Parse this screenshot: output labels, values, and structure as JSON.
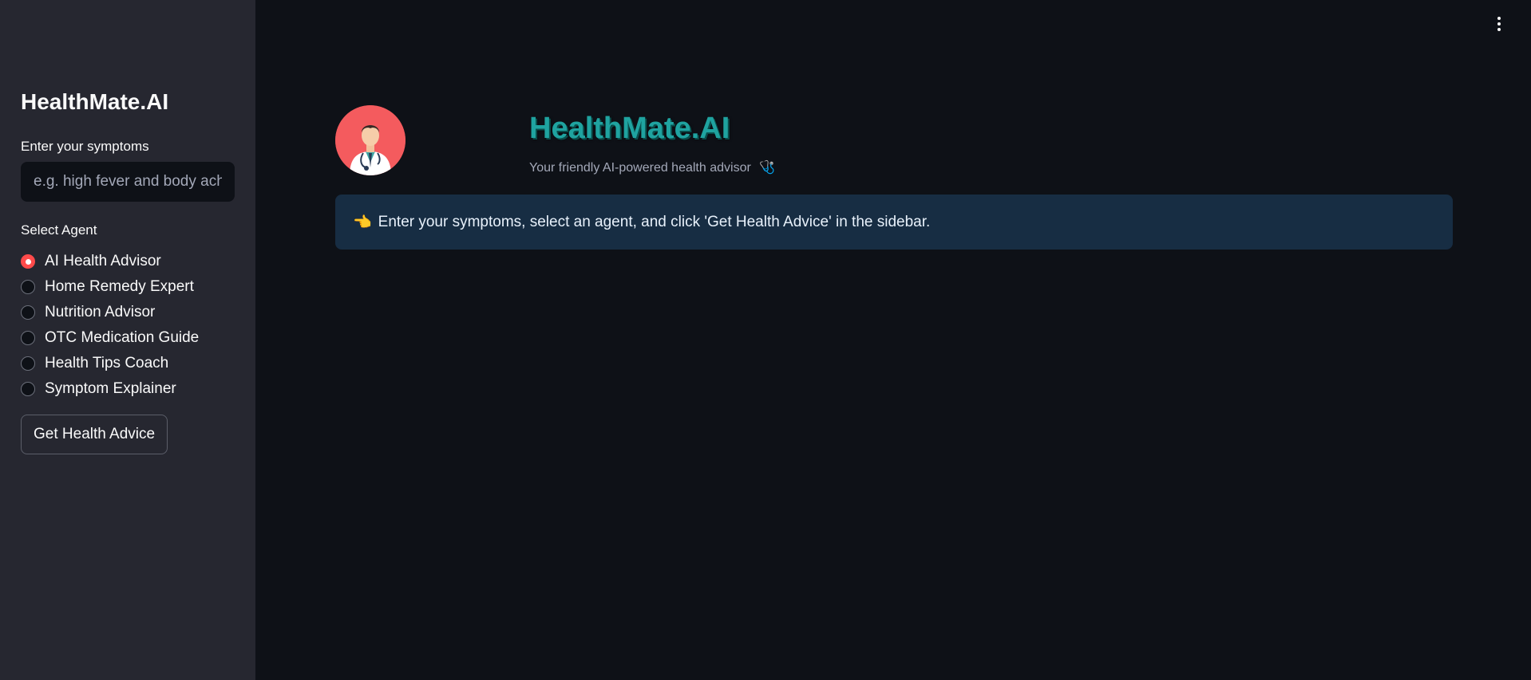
{
  "sidebar": {
    "title": "HealthMate.AI",
    "symptoms_label": "Enter your symptoms",
    "symptoms_placeholder": "e.g. high fever and body ache",
    "symptoms_value": "",
    "agent_label": "Select Agent",
    "agents": [
      {
        "label": "AI Health Advisor",
        "selected": true
      },
      {
        "label": "Home Remedy Expert",
        "selected": false
      },
      {
        "label": "Nutrition Advisor",
        "selected": false
      },
      {
        "label": "OTC Medication Guide",
        "selected": false
      },
      {
        "label": "Health Tips Coach",
        "selected": false
      },
      {
        "label": "Symptom Explainer",
        "selected": false
      }
    ],
    "button_label": "Get Health Advice"
  },
  "main": {
    "title": "HealthMate.AI",
    "subtitle": "Your friendly AI-powered health advisor",
    "subtitle_icon": "🩺",
    "info_icon": "👈",
    "info_text": "Enter your symptoms, select an agent, and click 'Get Health Advice' in the sidebar."
  },
  "colors": {
    "accent": "#ff4b4b",
    "title": "#1fa3a0",
    "info_bg": "#172d43",
    "sidebar_bg": "#262730",
    "main_bg": "#0e1117",
    "avatar_bg": "#f45b5e"
  },
  "icons": {
    "menu": "vertical-ellipsis-icon",
    "avatar": "doctor-avatar-icon"
  }
}
